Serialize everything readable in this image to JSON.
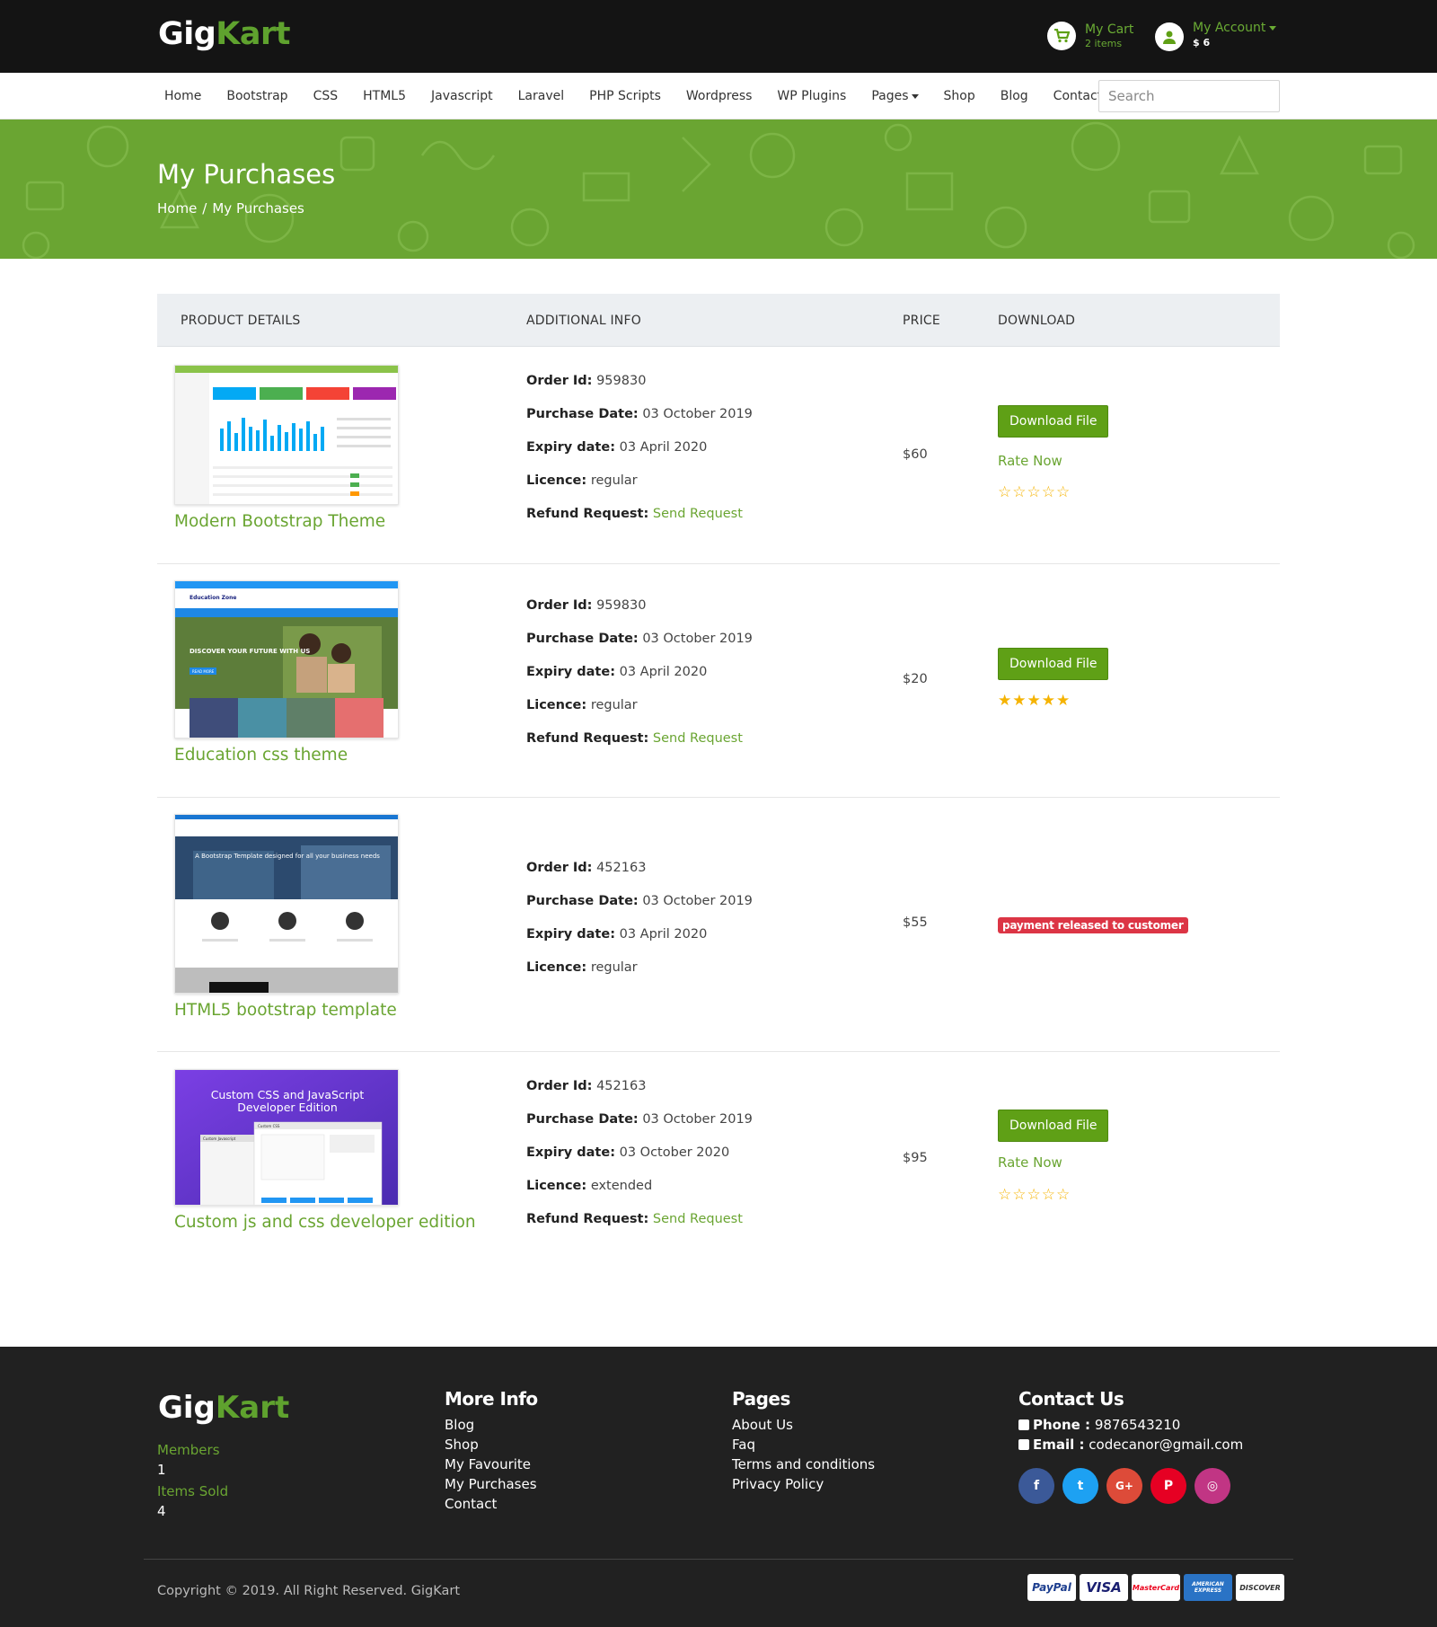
{
  "brand": {
    "part1": "Gig",
    "part2": "Kart"
  },
  "header": {
    "cart_label": "My Cart",
    "cart_items": "2 items",
    "account_label": "My Account",
    "account_balance": "$ 6"
  },
  "nav": {
    "items": [
      "Home",
      "Bootstrap",
      "CSS",
      "HTML5",
      "Javascript",
      "Laravel",
      "PHP Scripts",
      "Wordpress",
      "WP Plugins",
      "Pages",
      "Shop",
      "Blog",
      "Contact"
    ],
    "search_placeholder": "Search"
  },
  "banner": {
    "title": "My Purchases",
    "breadcrumb_home": "Home",
    "breadcrumb_sep": "/",
    "breadcrumb_current": "My Purchases"
  },
  "table": {
    "headers": [
      "PRODUCT DETAILS",
      "ADDITIONAL INFO",
      "PRICE",
      "DOWNLOAD"
    ],
    "labels": {
      "order_id": "Order Id:",
      "purchase_date": "Purchase Date:",
      "expiry_date": "Expiry date:",
      "licence": "Licence:",
      "refund": "Refund Request:"
    },
    "download_label": "Download File",
    "rate_label": "Rate Now",
    "refund_link": "Send Request",
    "rows": [
      {
        "name": "Modern Bootstrap Theme",
        "order_id": "959830",
        "purchase_date": "03 October 2019",
        "expiry_date": "03 April 2020",
        "licence": "regular",
        "price": "$60",
        "rating": 0
      },
      {
        "name": "Education css theme",
        "order_id": "959830",
        "purchase_date": "03 October 2019",
        "expiry_date": "03 April 2020",
        "licence": "regular",
        "price": "$20",
        "rating": 5
      },
      {
        "name": "HTML5 bootstrap template",
        "order_id": "452163",
        "purchase_date": "03 October 2019",
        "expiry_date": "03 April 2020",
        "licence": "regular",
        "price": "$55",
        "status_badge": "payment released to customer"
      },
      {
        "name": "Custom js and css developer edition",
        "order_id": "452163",
        "purchase_date": "03 October 2019",
        "expiry_date": "03 October 2020",
        "licence": "extended",
        "price": "$95",
        "rating": 0
      }
    ],
    "thumb_texts": {
      "edu_brand": "Education Zone",
      "edu_hero": "DISCOVER YOUR FUTURE WITH US",
      "edu_btn": "READ MORE",
      "html5_hero": "A Bootstrap Template designed for all your business needs",
      "custom_title": "Custom CSS and JavaScript Developer Edition",
      "custom_js": "Custom Javascript",
      "custom_css": "Custom CSS"
    }
  },
  "footer": {
    "members_label": "Members",
    "members_value": "1",
    "items_sold_label": "Items Sold",
    "items_sold_value": "4",
    "more_info_title": "More Info",
    "more_info_links": [
      "Blog",
      "Shop",
      "My Favourite",
      "My Purchases",
      "Contact"
    ],
    "pages_title": "Pages",
    "pages_links": [
      "About Us",
      "Faq",
      "Terms and conditions",
      "Privacy Policy"
    ],
    "contact_title": "Contact Us",
    "phone_label": "Phone :",
    "phone_value": "9876543210",
    "email_label": "Email :",
    "email_value": "codecanor@gmail.com",
    "social": [
      {
        "name": "facebook-icon",
        "color": "#3b5998",
        "glyph": "f"
      },
      {
        "name": "twitter-icon",
        "color": "#1da1f2",
        "glyph": "t"
      },
      {
        "name": "google-plus-icon",
        "color": "#dd4b39",
        "glyph": "G+"
      },
      {
        "name": "pinterest-icon",
        "color": "#e60023",
        "glyph": "P"
      },
      {
        "name": "instagram-icon",
        "color": "#c13584",
        "glyph": "◎"
      }
    ],
    "copyright": "Copyright © 2019. All Right Reserved. GigKart",
    "payment_cards": [
      "PayPal",
      "VISA",
      "MasterCard",
      "AMERICAN EXPRESS",
      "DISCOVER"
    ]
  },
  "colors": {
    "brand_green": "#6aa532",
    "button_green": "#5fa016",
    "dark": "#141414",
    "badge_red": "#dc3545"
  }
}
